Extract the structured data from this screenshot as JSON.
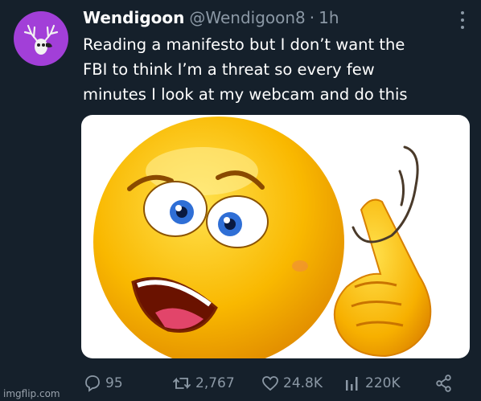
{
  "tweet": {
    "display_name": "Wendigoon",
    "handle": "@Wendigoon8",
    "separator": "·",
    "time": "1h",
    "text_lines": [
      "Reading a manifesto but I don’t want the",
      "FBI to think I’m a threat so every few",
      "minutes I look at my webcam and do this"
    ]
  },
  "avatar": {
    "icon": "deer-skull-icon",
    "color": "#a23fd8"
  },
  "media": {
    "description_icon": "crazy-emoji-icon"
  },
  "actions": {
    "replies": "95",
    "retweets": "2,767",
    "likes": "24.8K",
    "views": "220K"
  },
  "watermark": "imgflip.com",
  "colors": {
    "background": "#15202b",
    "text": "#e7e9ea",
    "muted": "#8b98a5",
    "emoji": "#f7b500"
  }
}
